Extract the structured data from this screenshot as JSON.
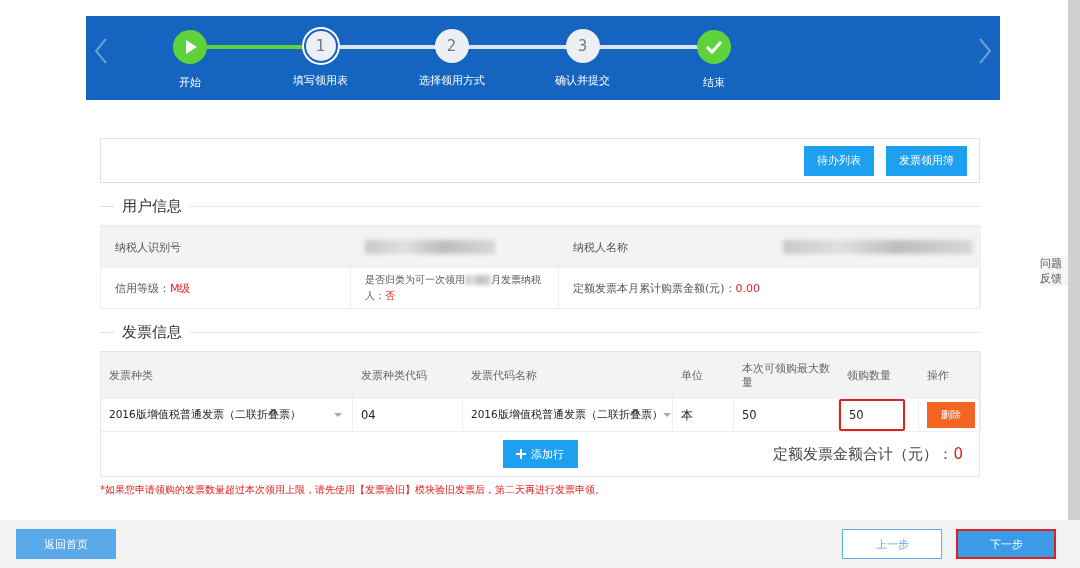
{
  "steps": [
    {
      "kind": "play",
      "label": "开始",
      "selected": false
    },
    {
      "kind": "number",
      "number": "1",
      "label": "填写领用表",
      "selected": true
    },
    {
      "kind": "number",
      "number": "2",
      "label": "选择领用方式",
      "selected": false
    },
    {
      "kind": "number",
      "number": "3",
      "label": "确认并提交",
      "selected": false
    },
    {
      "kind": "check",
      "label": "结束",
      "selected": false
    }
  ],
  "toolbar": {
    "buttons": [
      "待办列表",
      "发票领用簿"
    ]
  },
  "user_info": {
    "title": "用户信息",
    "taxpayer_id_label": "纳税人识别号",
    "taxpayer_name_label": "纳税人名称",
    "credit_label": "信用等级：",
    "credit_value": "M级",
    "quarterly_label_start": "是否归类为可一次领用",
    "quarterly_label_end": "月发票纳税人：",
    "quarterly_value": "否",
    "amount_label": "定额发票本月累计购票金额(元)：",
    "amount_value": "0.00"
  },
  "invoice_info": {
    "title": "发票信息",
    "columns": [
      "发票种类",
      "发票种类代码",
      "发票代码名称",
      "单位",
      "本次可领购最大数量",
      "领购数量",
      "操作"
    ],
    "rows": [
      {
        "type": "2016版增值税普通发票（二联折叠票）",
        "type_code": "04",
        "code_name": "2016版增值税普通发票（二联折叠票）",
        "unit": "本",
        "max": "50",
        "quantity": "50",
        "quantity_highlighted": true,
        "action": "删除"
      }
    ],
    "add_row": "添加行",
    "total_label": "定额发票金额合计（元）：",
    "total_value": "0"
  },
  "note": "*如果您申请领购的发票数量超过本次领用上限，请先使用【发票验旧】模块验旧发票后，第二天再进行发票申领。",
  "footer": {
    "home": "返回首页",
    "prev": "上一步",
    "next": "下一步",
    "next_highlighted": true
  },
  "feedback": [
    "问题",
    "反馈"
  ]
}
